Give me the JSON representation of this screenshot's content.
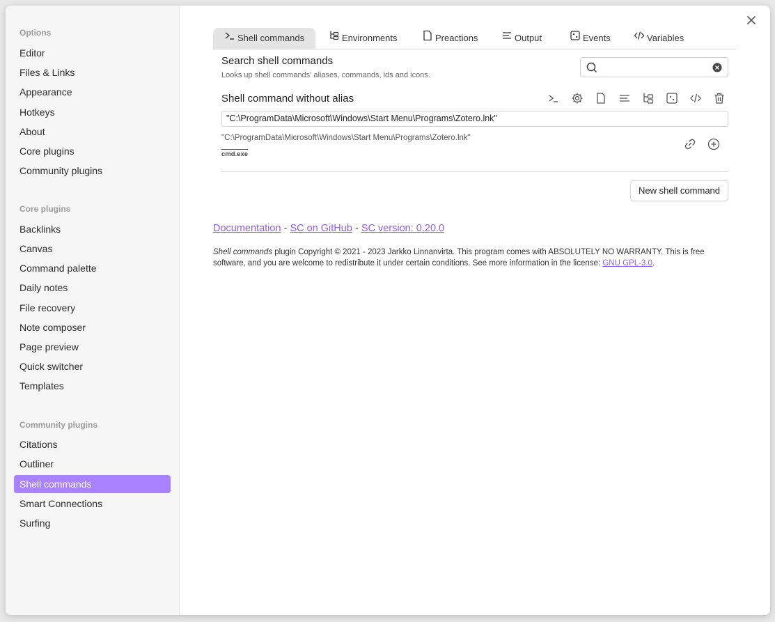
{
  "sidebar": {
    "options_heading": "Options",
    "options": [
      "Editor",
      "Files & Links",
      "Appearance",
      "Hotkeys",
      "About",
      "Core plugins",
      "Community plugins"
    ],
    "core_heading": "Core plugins",
    "core": [
      "Backlinks",
      "Canvas",
      "Command palette",
      "Daily notes",
      "File recovery",
      "Note composer",
      "Page preview",
      "Quick switcher",
      "Templates"
    ],
    "community_heading": "Community plugins",
    "community": [
      "Citations",
      "Outliner",
      "Shell commands",
      "Smart Connections",
      "Surfing"
    ],
    "active_item": "Shell commands"
  },
  "tabs": [
    {
      "label": "Shell commands",
      "icon": "terminal-icon"
    },
    {
      "label": "Environments",
      "icon": "tree-icon"
    },
    {
      "label": "Preactions",
      "icon": "file-icon"
    },
    {
      "label": "Output",
      "icon": "lines-icon"
    },
    {
      "label": "Events",
      "icon": "dice-icon"
    },
    {
      "label": "Variables",
      "icon": "code-icon"
    }
  ],
  "search": {
    "title": "Search shell commands",
    "description": "Looks up shell commands' aliases, commands, ids and icons.",
    "value": "",
    "placeholder": ""
  },
  "command": {
    "title": "Shell command without alias",
    "value": "\"C:\\ProgramData\\Microsoft\\Windows\\Start Menu\\Programs\\Zotero.lnk\"",
    "preview": "\"C:\\ProgramData\\Microsoft\\Windows\\Start Menu\\Programs\\Zotero.lnk\"",
    "shell": "cmd.exe"
  },
  "new_button": "New shell command",
  "links": {
    "documentation": "Documentation",
    "separator": "-",
    "github": "SC on GitHub",
    "version": "SC version: 0.20.0"
  },
  "copyright": {
    "plugin_name": "Shell commands",
    "text": " plugin Copyright © 2021 - 2023 Jarkko Linnanvirta. This program comes with ABSOLUTELY NO WARRANTY. This is free software, and you are welcome to redistribute it under certain conditions. See more information in the license: ",
    "license": "GNU GPL-3.0",
    "end": "."
  },
  "colors": {
    "accent": "#a882ff",
    "link": "#8a5cf5"
  }
}
